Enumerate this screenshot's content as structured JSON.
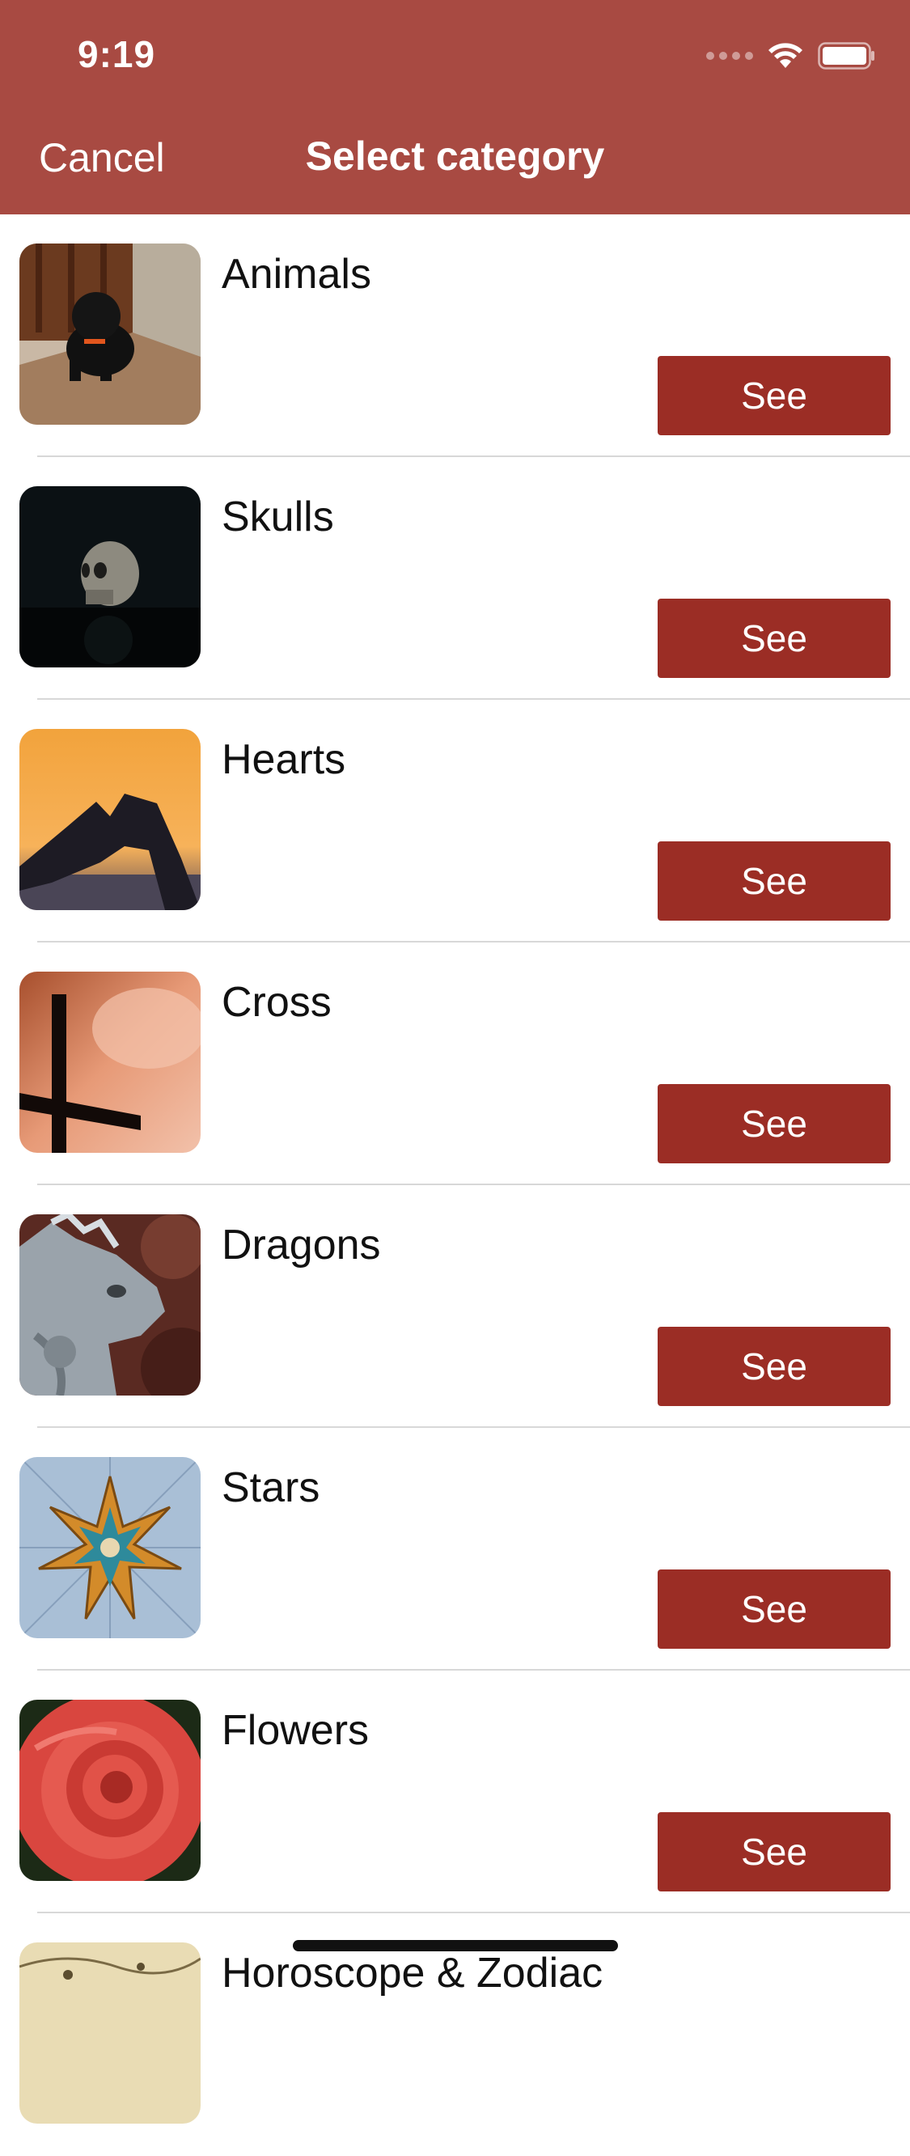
{
  "status": {
    "time": "9:19"
  },
  "nav": {
    "cancel": "Cancel",
    "title": "Select category"
  },
  "categories": [
    {
      "label": "Animals",
      "button": "See",
      "image": "dog-photo"
    },
    {
      "label": "Skulls",
      "button": "See",
      "image": "skull-photo"
    },
    {
      "label": "Hearts",
      "button": "See",
      "image": "heart-hands-photo"
    },
    {
      "label": "Cross",
      "button": "See",
      "image": "cross-photo"
    },
    {
      "label": "Dragons",
      "button": "See",
      "image": "iguana-photo"
    },
    {
      "label": "Stars",
      "button": "See",
      "image": "star-photo"
    },
    {
      "label": "Flowers",
      "button": "See",
      "image": "rose-photo"
    },
    {
      "label": "Horoscope & Zodiac",
      "image": "zodiac-map-photo"
    }
  ],
  "colors": {
    "header": "#a84a42",
    "button": "#9b2d25"
  }
}
